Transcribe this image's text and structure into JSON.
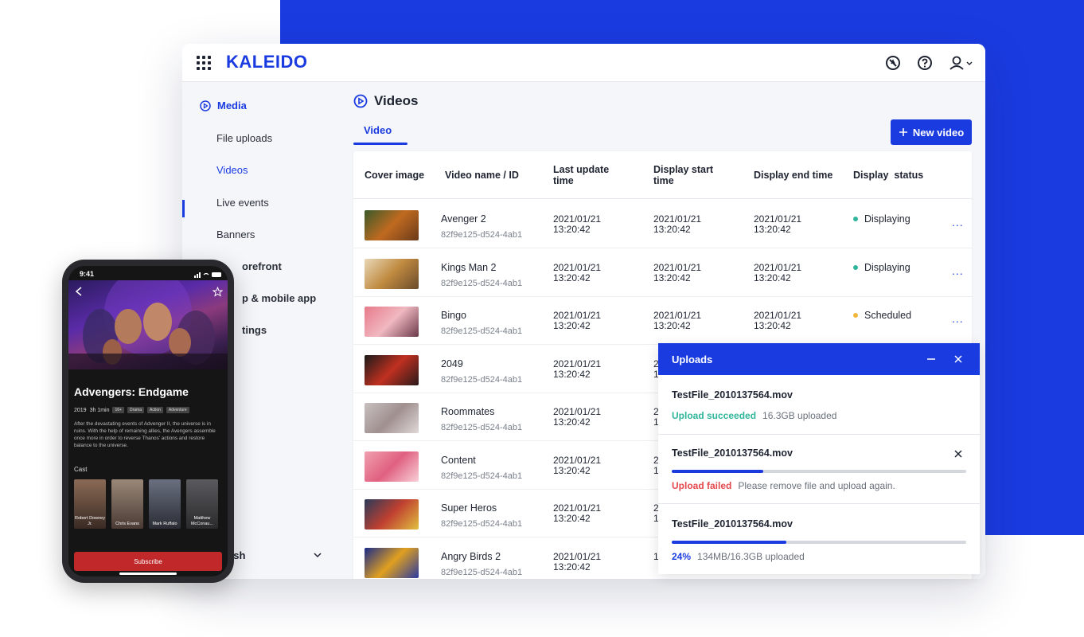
{
  "brand": {
    "name": "KALEIDO",
    "accent": "#1a3be0"
  },
  "sidebar": {
    "section": "Media",
    "items": [
      {
        "label": "File uploads"
      },
      {
        "label": "Videos"
      },
      {
        "label": "Live events"
      },
      {
        "label": "Banners"
      },
      {
        "label": "orefront"
      },
      {
        "label": "p & mobile app"
      },
      {
        "label": "tings"
      }
    ],
    "language": "lish"
  },
  "main": {
    "title": "Videos",
    "tab": "Video",
    "new_button": "New video"
  },
  "table": {
    "headers": [
      "Cover image",
      "Video name / ID",
      "Last update time",
      "Display start time",
      "Display end time",
      "Display  status"
    ],
    "rows": [
      {
        "name": "Avenger 2",
        "id": "82f9e125-d524-4ab1",
        "last_date": "2021/01/21",
        "last_time": "13:20:42",
        "start_date": "2021/01/21",
        "start_time": "13:20:42",
        "end_date": "2021/01/21",
        "end_time": "13:20:42",
        "status": "Displaying",
        "more": "..."
      },
      {
        "name": "Kings Man 2",
        "id": "82f9e125-d524-4ab1",
        "last_date": "2021/01/21",
        "last_time": "13:20:42",
        "start_date": "2021/01/21",
        "start_time": "13:20:42",
        "end_date": "2021/01/21",
        "end_time": "13:20:42",
        "status": "Displaying",
        "more": "..."
      },
      {
        "name": "Bingo",
        "id": "82f9e125-d524-4ab1",
        "last_date": "2021/01/21",
        "last_time": "13:20:42",
        "start_date": "2021/01/21",
        "start_time": "13:20:42",
        "end_date": "2021/01/21",
        "end_time": "13:20:42",
        "status": "Scheduled",
        "more": "..."
      },
      {
        "name": "2049",
        "id": "82f9e125-d524-4ab1",
        "last_date": "2021/01/21",
        "last_time": "13:20:42",
        "start_date": "2",
        "start_time": "1",
        "end_date": "",
        "end_time": "",
        "status": "",
        "more": ""
      },
      {
        "name": "Roommates",
        "id": "82f9e125-d524-4ab1",
        "last_date": "2021/01/21",
        "last_time": "13:20:42",
        "start_date": "2",
        "start_time": "1",
        "end_date": "",
        "end_time": "",
        "status": "",
        "more": ""
      },
      {
        "name": "Content",
        "id": "82f9e125-d524-4ab1",
        "last_date": "2021/01/21",
        "last_time": "13:20:42",
        "start_date": "2",
        "start_time": "1",
        "end_date": "",
        "end_time": "",
        "status": "",
        "more": ""
      },
      {
        "name": "Super Heros",
        "id": "82f9e125-d524-4ab1",
        "last_date": "2021/01/21",
        "last_time": "13:20:42",
        "start_date": "2",
        "start_time": "1",
        "end_date": "",
        "end_time": "",
        "status": "",
        "more": ""
      },
      {
        "name": "Angry Birds 2",
        "id": "82f9e125-d524-4ab1",
        "last_date": "2021/01/21",
        "last_time": "13:20:42",
        "start_date": "1",
        "start_time": "",
        "end_date": "",
        "end_time": "",
        "status": "",
        "more": ""
      }
    ],
    "status_colors": {
      "Displaying": "#2fb59a",
      "Scheduled": "#f0b73c"
    }
  },
  "uploads": {
    "title": "Uploads",
    "items": [
      {
        "file": "TestFile_2010137564.mov",
        "state": "Upload succeeded",
        "detail": "16.3GB uploaded",
        "state_color": "#2fb59a"
      },
      {
        "file": "TestFile_2010137564.mov",
        "state": "Upload failed",
        "detail": "Please remove file and upload again.",
        "state_color": "#e5484d",
        "progress": 0.31
      },
      {
        "file": "TestFile_2010137564.mov",
        "state": "24%",
        "detail": "134MB/16.3GB uploaded",
        "state_color": "#1a3be0",
        "progress": 0.39
      }
    ]
  },
  "phone": {
    "time": "9:41",
    "title": "Advengers: Endgame",
    "year": "2019",
    "duration": "3h 1min",
    "tags": [
      "16+",
      "Drama",
      "Action",
      "Adventure"
    ],
    "description": "After the devastating events of Advenger II, the universe is in ruins. With the help of remaining allies, the Avengers assemble once more in order to reverse Thanos' actions and restore balance to the universe.",
    "cast_label": "Cast",
    "cast": [
      {
        "name": "Robert Downey Jr."
      },
      {
        "name": "Chris Evans"
      },
      {
        "name": "Mark Ruffalo"
      },
      {
        "name": "Matthew McConau..."
      }
    ],
    "subscribe": "Subscribe"
  }
}
